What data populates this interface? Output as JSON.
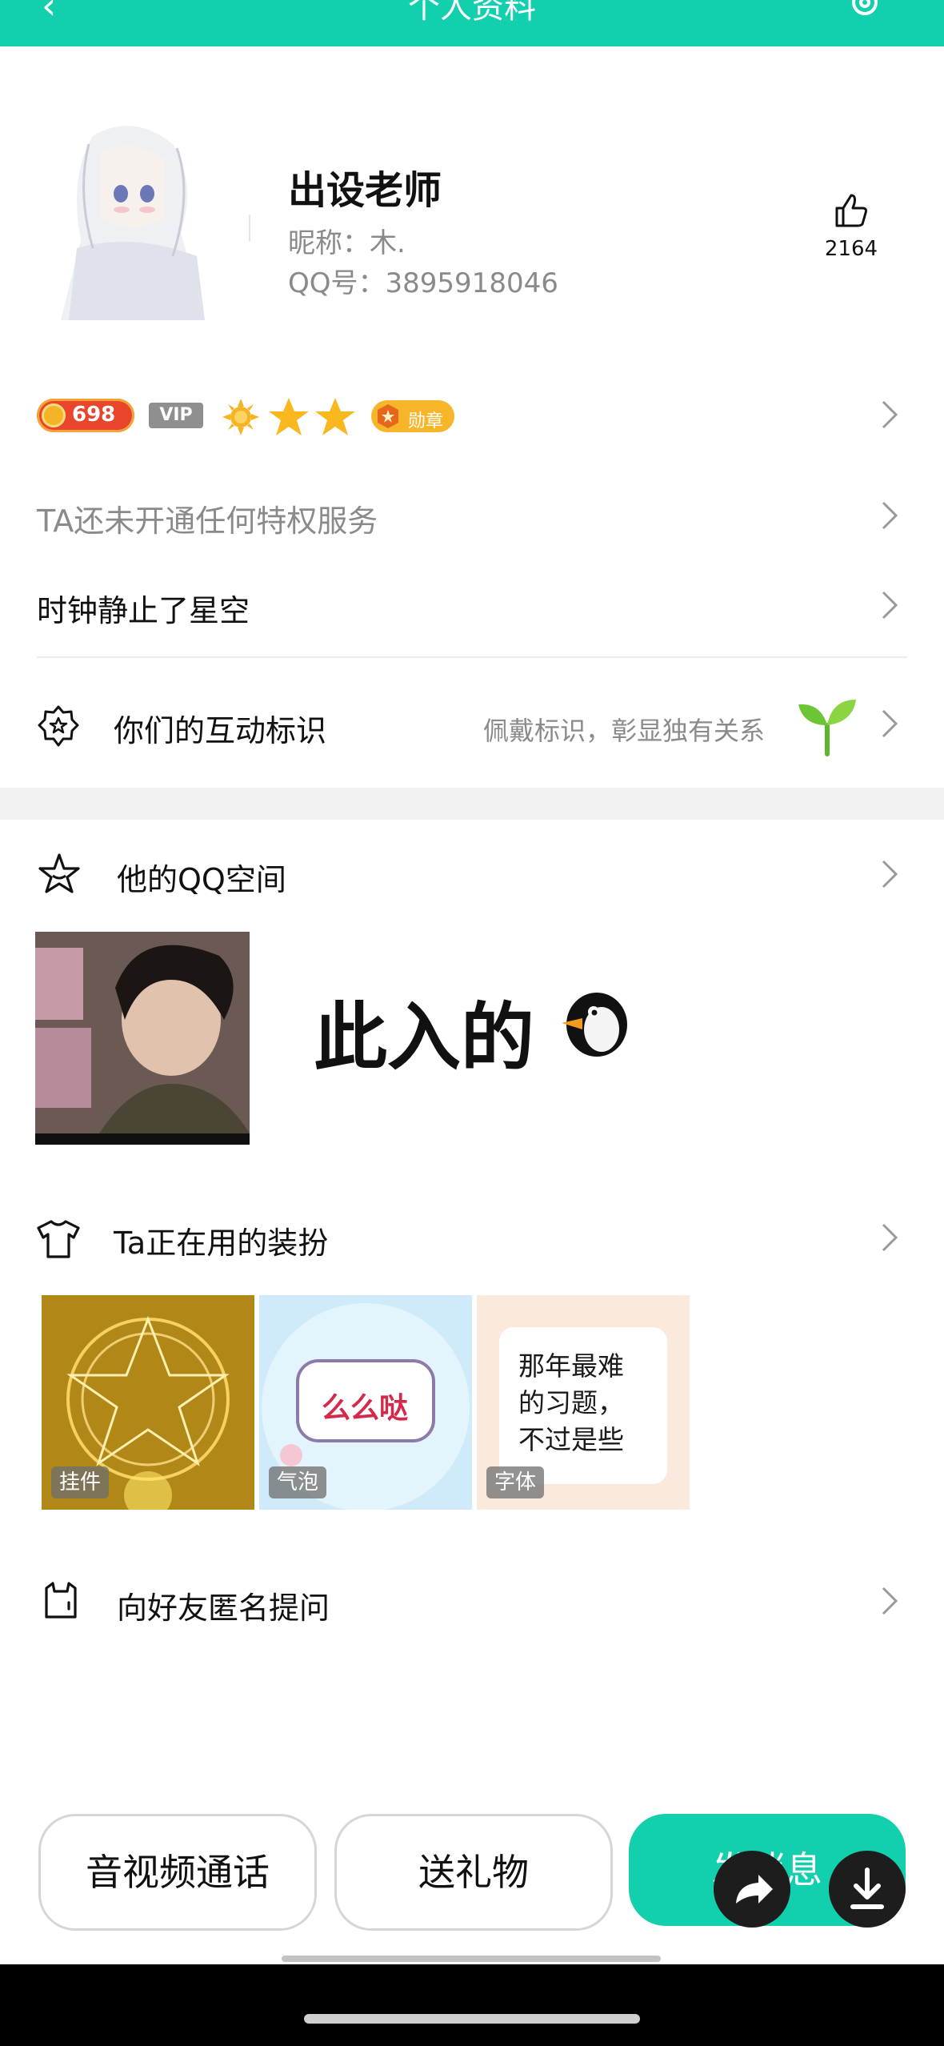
{
  "header": {
    "title": "个人资料",
    "back_icon": "back-arrow-icon",
    "settings_icon": "gear-icon",
    "color": "#12cfae"
  },
  "profile": {
    "name": "出设老师",
    "nickname": "昵称：木.",
    "qq": "QQ号：3895918046",
    "likes": "2164"
  },
  "badges": {
    "coin": "698",
    "vip": "VIP",
    "medal": "勋章"
  },
  "privilege": {
    "text": "TA还未开通任何特权服务"
  },
  "signature": {
    "text": "时钟静止了星空"
  },
  "interaction": {
    "label": "你们的互动标识",
    "hint": "佩戴标识，彰显独有关系"
  },
  "qzone": {
    "label": "他的QQ空间",
    "post_text": "此入的"
  },
  "dressup": {
    "label": "Ta正在用的装扮",
    "tiles": [
      {
        "tag": "挂件"
      },
      {
        "tag": "气泡",
        "bubble_text": "么么哒"
      },
      {
        "tag": "字体",
        "sample_lines": [
          "那年最难",
          "的习题，",
          "不过是些"
        ]
      }
    ]
  },
  "anonymous": {
    "label": "向好友匿名提问"
  },
  "actions": {
    "call": "音视频通话",
    "gift": "送礼物",
    "message": "发消息"
  }
}
